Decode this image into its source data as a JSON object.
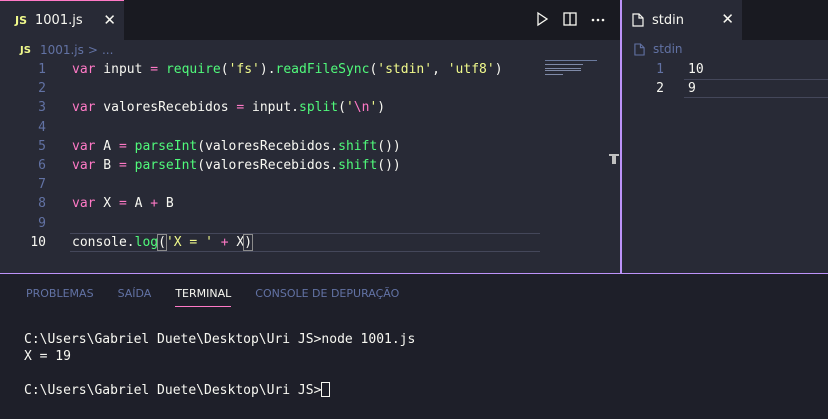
{
  "editor": {
    "tab": {
      "badge": "JS",
      "label": "1001.js",
      "close": "✕"
    },
    "breadcrumb": {
      "badge": "JS",
      "file": "1001.js",
      "sep": ">",
      "rest": "..."
    },
    "lines": [
      {
        "n": "1",
        "parts": [
          [
            "kw",
            "var"
          ],
          [
            "p",
            " input "
          ],
          [
            "kw",
            "="
          ],
          [
            "p",
            " "
          ],
          [
            "fn",
            "require"
          ],
          [
            "p",
            "("
          ],
          [
            "str",
            "'fs'"
          ],
          [
            "p",
            ")."
          ],
          [
            "fn",
            "readFileSync"
          ],
          [
            "p",
            "("
          ],
          [
            "str",
            "'stdin'"
          ],
          [
            "p",
            ", "
          ],
          [
            "str",
            "'utf8'"
          ],
          [
            "p",
            ")"
          ]
        ]
      },
      {
        "n": "2",
        "parts": []
      },
      {
        "n": "3",
        "parts": [
          [
            "kw",
            "var"
          ],
          [
            "p",
            " valoresRecebidos "
          ],
          [
            "kw",
            "="
          ],
          [
            "p",
            " input."
          ],
          [
            "fn",
            "split"
          ],
          [
            "p",
            "("
          ],
          [
            "str",
            "'"
          ],
          [
            "esc",
            "\\n"
          ],
          [
            "str",
            "'"
          ],
          [
            "p",
            ")"
          ]
        ]
      },
      {
        "n": "4",
        "parts": []
      },
      {
        "n": "5",
        "parts": [
          [
            "kw",
            "var"
          ],
          [
            "p",
            " A "
          ],
          [
            "kw",
            "="
          ],
          [
            "p",
            " "
          ],
          [
            "fn",
            "parseInt"
          ],
          [
            "p",
            "(valoresRecebidos."
          ],
          [
            "fn",
            "shift"
          ],
          [
            "p",
            "())"
          ]
        ]
      },
      {
        "n": "6",
        "parts": [
          [
            "kw",
            "var"
          ],
          [
            "p",
            " B "
          ],
          [
            "kw",
            "="
          ],
          [
            "p",
            " "
          ],
          [
            "fn",
            "parseInt"
          ],
          [
            "p",
            "(valoresRecebidos."
          ],
          [
            "fn",
            "shift"
          ],
          [
            "p",
            "())"
          ]
        ]
      },
      {
        "n": "7",
        "parts": []
      },
      {
        "n": "8",
        "parts": [
          [
            "kw",
            "var"
          ],
          [
            "p",
            " X "
          ],
          [
            "kw",
            "="
          ],
          [
            "p",
            " A "
          ],
          [
            "kw",
            "+"
          ],
          [
            "p",
            " B"
          ]
        ]
      },
      {
        "n": "9",
        "parts": []
      },
      {
        "n": "10",
        "parts": [
          [
            "p",
            "console."
          ],
          [
            "fn",
            "log"
          ],
          [
            "hl",
            "("
          ],
          [
            "str",
            "'X = '"
          ],
          [
            "p",
            " "
          ],
          [
            "kw",
            "+"
          ],
          [
            "p",
            " X"
          ],
          [
            "hl",
            ")"
          ]
        ]
      }
    ]
  },
  "stdin": {
    "tab": {
      "label": "stdin",
      "close": "✕"
    },
    "breadcrumb": "stdin",
    "lines": [
      {
        "n": "1",
        "text": "10"
      },
      {
        "n": "2",
        "text": "9"
      }
    ]
  },
  "panel": {
    "tabs": [
      {
        "label": "PROBLEMAS",
        "active": false
      },
      {
        "label": "SAÍDA",
        "active": false
      },
      {
        "label": "TERMINAL",
        "active": true
      },
      {
        "label": "CONSOLE DE DEPURAÇÃO",
        "active": false
      }
    ],
    "terminal": {
      "lines": [
        "C:\\Users\\Gabriel Duete\\Desktop\\Uri JS>node 1001.js",
        "X = 19",
        "",
        "C:\\Users\\Gabriel Duete\\Desktop\\Uri JS>"
      ]
    }
  },
  "colors": {
    "keyword": "#ff79c6",
    "function": "#50fa7b",
    "string": "#f1fa8c",
    "accent": "#bd93f9",
    "comment": "#6272a4"
  }
}
